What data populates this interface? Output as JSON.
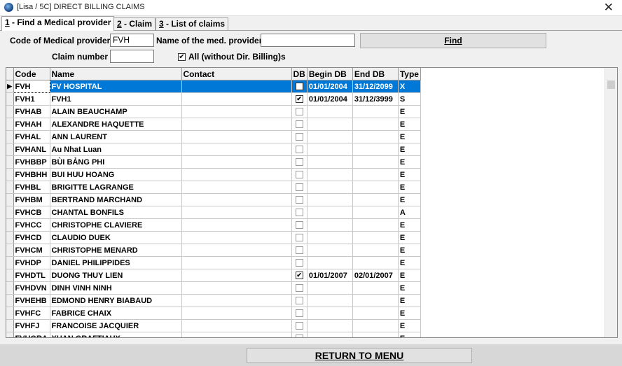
{
  "window": {
    "title": "[Lisa / 5C] DIRECT BILLING CLAIMS",
    "close": "✕"
  },
  "tabs": [
    {
      "key": "1",
      "label": " - Find a Medical provider"
    },
    {
      "key": "2",
      "label": " - Claim"
    },
    {
      "key": "3",
      "label": " - List of claims"
    }
  ],
  "form": {
    "code_label": "Code of Medical provider",
    "code_value": "FVH",
    "name_label": "Name of the med. provider",
    "name_value": "",
    "claim_label": "Claim number",
    "claim_value": "",
    "all_label": "All (without Dir. Billing)s",
    "all_checked": "✔",
    "find_label": "Find"
  },
  "grid": {
    "headers": {
      "code": "Code",
      "name": "Name",
      "contact": "Contact",
      "db": "DB",
      "begin": "Begin DB",
      "end": "End DB",
      "type": "Type"
    },
    "rows": [
      {
        "code": "FVH",
        "name": "FV HOSPITAL",
        "contact": "",
        "db": "✔",
        "begin": "01/01/2004",
        "end": "31/12/2099",
        "type": "X"
      },
      {
        "code": "FVH1",
        "name": "FVH1",
        "contact": "",
        "db": "✔",
        "begin": "01/01/2004",
        "end": "31/12/3999",
        "type": "S"
      },
      {
        "code": "FVHAB",
        "name": "ALAIN BEAUCHAMP",
        "contact": "",
        "db": "",
        "begin": "",
        "end": "",
        "type": "E"
      },
      {
        "code": "FVHAH",
        "name": "ALEXANDRE HAQUETTE",
        "contact": "",
        "db": "",
        "begin": "",
        "end": "",
        "type": "E"
      },
      {
        "code": "FVHAL",
        "name": "ANN LAURENT",
        "contact": "",
        "db": "",
        "begin": "",
        "end": "",
        "type": "E"
      },
      {
        "code": "FVHANL",
        "name": "Au Nhat Luan",
        "contact": "",
        "db": "",
        "begin": "",
        "end": "",
        "type": "E"
      },
      {
        "code": "FVHBBP",
        "name": "BÙI BẢNG PHI",
        "contact": "",
        "db": "",
        "begin": "",
        "end": "",
        "type": "E"
      },
      {
        "code": "FVHBHH",
        "name": "BUI HUU HOANG",
        "contact": "",
        "db": "",
        "begin": "",
        "end": "",
        "type": "E"
      },
      {
        "code": "FVHBL",
        "name": "BRIGITTE LAGRANGE",
        "contact": "",
        "db": "",
        "begin": "",
        "end": "",
        "type": "E"
      },
      {
        "code": "FVHBM",
        "name": "BERTRAND MARCHAND",
        "contact": "",
        "db": "",
        "begin": "",
        "end": "",
        "type": "E"
      },
      {
        "code": "FVHCB",
        "name": "CHANTAL BONFILS",
        "contact": "",
        "db": "",
        "begin": "",
        "end": "",
        "type": "A"
      },
      {
        "code": "FVHCC",
        "name": "CHRISTOPHE CLAVIERE",
        "contact": "",
        "db": "",
        "begin": "",
        "end": "",
        "type": "E"
      },
      {
        "code": "FVHCD",
        "name": "CLAUDIO DUEK",
        "contact": "",
        "db": "",
        "begin": "",
        "end": "",
        "type": "E"
      },
      {
        "code": "FVHCM",
        "name": "CHRISTOPHE MENARD",
        "contact": "",
        "db": "",
        "begin": "",
        "end": "",
        "type": "E"
      },
      {
        "code": "FVHDP",
        "name": "DANIEL PHILIPPIDES",
        "contact": "",
        "db": "",
        "begin": "",
        "end": "",
        "type": "E"
      },
      {
        "code": "FVHDTL",
        "name": "DUONG THUY LIEN",
        "contact": "",
        "db": "✔",
        "begin": "01/01/2007",
        "end": "02/01/2007",
        "type": "E"
      },
      {
        "code": "FVHDVN",
        "name": "DINH VINH NINH",
        "contact": "",
        "db": "",
        "begin": "",
        "end": "",
        "type": "E"
      },
      {
        "code": "FVHEHB",
        "name": "EDMOND HENRY BIABAUD",
        "contact": "",
        "db": "",
        "begin": "",
        "end": "",
        "type": "E"
      },
      {
        "code": "FVHFC",
        "name": "FABRICE CHAIX",
        "contact": "",
        "db": "",
        "begin": "",
        "end": "",
        "type": "E"
      },
      {
        "code": "FVHFJ",
        "name": "FRANCOISE JACQUIER",
        "contact": "",
        "db": "",
        "begin": "",
        "end": "",
        "type": "E"
      },
      {
        "code": "FVHGRA",
        "name": "XUAN GRAFTIAUX",
        "contact": "",
        "db": "",
        "begin": "",
        "end": "",
        "type": "E"
      }
    ]
  },
  "footer": {
    "return_label": "RETURN TO MENU"
  }
}
